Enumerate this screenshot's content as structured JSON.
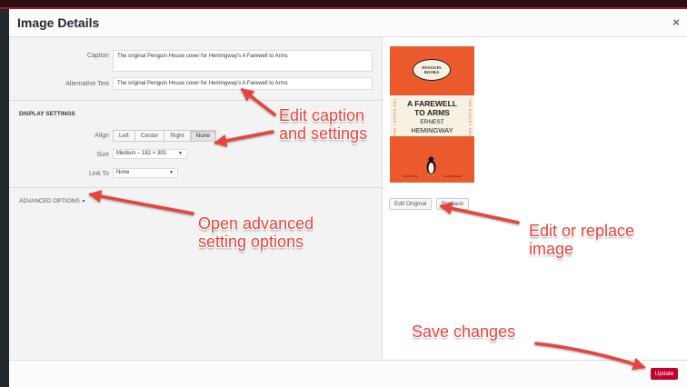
{
  "modal": {
    "title": "Image Details",
    "close_icon": "×"
  },
  "fields": {
    "caption_label": "Caption",
    "caption_value": "The original Penguin House cover for Hemingway's A Farewell to Arms",
    "alt_label": "Alternative Text",
    "alt_value": "The original Penguin House cover for Hemingway's A Farewell to Arms"
  },
  "display": {
    "heading": "DISPLAY SETTINGS",
    "align_label": "Align",
    "align_options": [
      "Left",
      "Center",
      "Right",
      "None"
    ],
    "align_selected": "None",
    "size_label": "Size",
    "size_value": "Medium – 182 × 300",
    "link_label": "Link To",
    "link_value": "None"
  },
  "advanced": {
    "label": "ADVANCED OPTIONS",
    "caret": "▼"
  },
  "cover": {
    "publisher_line1": "PENGUIN",
    "publisher_line2": "BOOKS",
    "title_line1": "A FAREWELL",
    "title_line2": "TO ARMS",
    "author_line1": "ERNEST",
    "author_line2": "HEMINGWAY",
    "spine_text": "THE BODLEY HEAD",
    "footer_left": "COMPLETE",
    "footer_right": "UNABRIDGED"
  },
  "image_actions": {
    "edit_original": "Edit Original",
    "replace": "Replace"
  },
  "footer": {
    "update_label": "Update"
  },
  "annotations": {
    "caption_line1": "Edit caption",
    "caption_line2": "and settings",
    "advanced_line1": "Open advanced",
    "advanced_line2": "setting options",
    "replace_line1": "Edit or replace",
    "replace_line2": "image",
    "save": "Save changes"
  },
  "colors": {
    "accent": "#c2002e",
    "annotation": "#e8433c",
    "cover_orange": "#ea5a2c"
  }
}
